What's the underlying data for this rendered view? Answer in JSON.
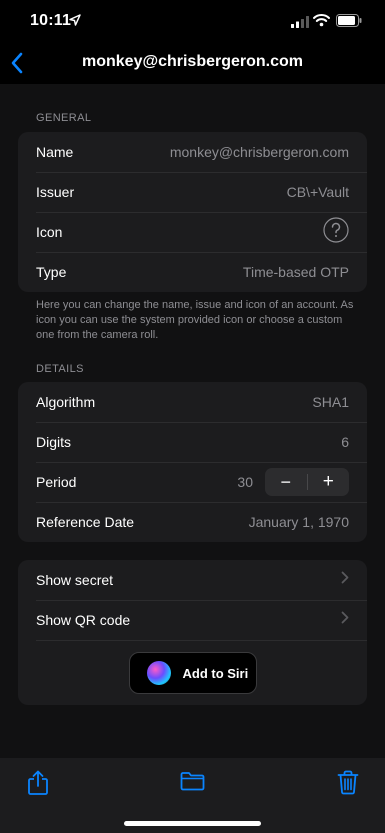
{
  "status_bar": {
    "time": "10:11",
    "icons": [
      "location-arrow-icon",
      "cellular-signal-icon",
      "wifi-icon",
      "battery-icon"
    ]
  },
  "nav": {
    "title": "monkey@chrisbergeron.com",
    "back_icon": "chevron-left-icon"
  },
  "general": {
    "header": "GENERAL",
    "rows": [
      {
        "label": "Name",
        "value": "monkey@chrisbergeron.com"
      },
      {
        "label": "Issuer",
        "value": "CB\\+Vault"
      },
      {
        "label": "Icon",
        "icon": "question-mark-circle-icon"
      },
      {
        "label": "Type",
        "value": "Time-based OTP"
      }
    ],
    "footer": "Here you can change the name, issue and icon of an account. As icon you can use the system provided icon or choose a custom one from the camera roll."
  },
  "details": {
    "header": "DETAILS",
    "rows": [
      {
        "label": "Algorithm",
        "value": "SHA1"
      },
      {
        "label": "Digits",
        "value": "6"
      },
      {
        "label": "Period",
        "value": "30"
      },
      {
        "label": "Reference Date",
        "value": "January 1, 1970"
      }
    ],
    "stepper": {
      "minus": "−",
      "plus": "+"
    }
  },
  "actions": {
    "rows": [
      {
        "label": "Show secret"
      },
      {
        "label": "Show QR code"
      }
    ],
    "siri_button": "Add to Siri"
  },
  "tab_bar": {
    "icons": [
      "share-icon",
      "folder-icon",
      "trash-icon"
    ]
  },
  "colors": {
    "accent": "#0a84ff",
    "background": "#000000",
    "content_background": "#111112",
    "group_background": "#1c1c1e",
    "secondary_text": "#8e8e93"
  }
}
